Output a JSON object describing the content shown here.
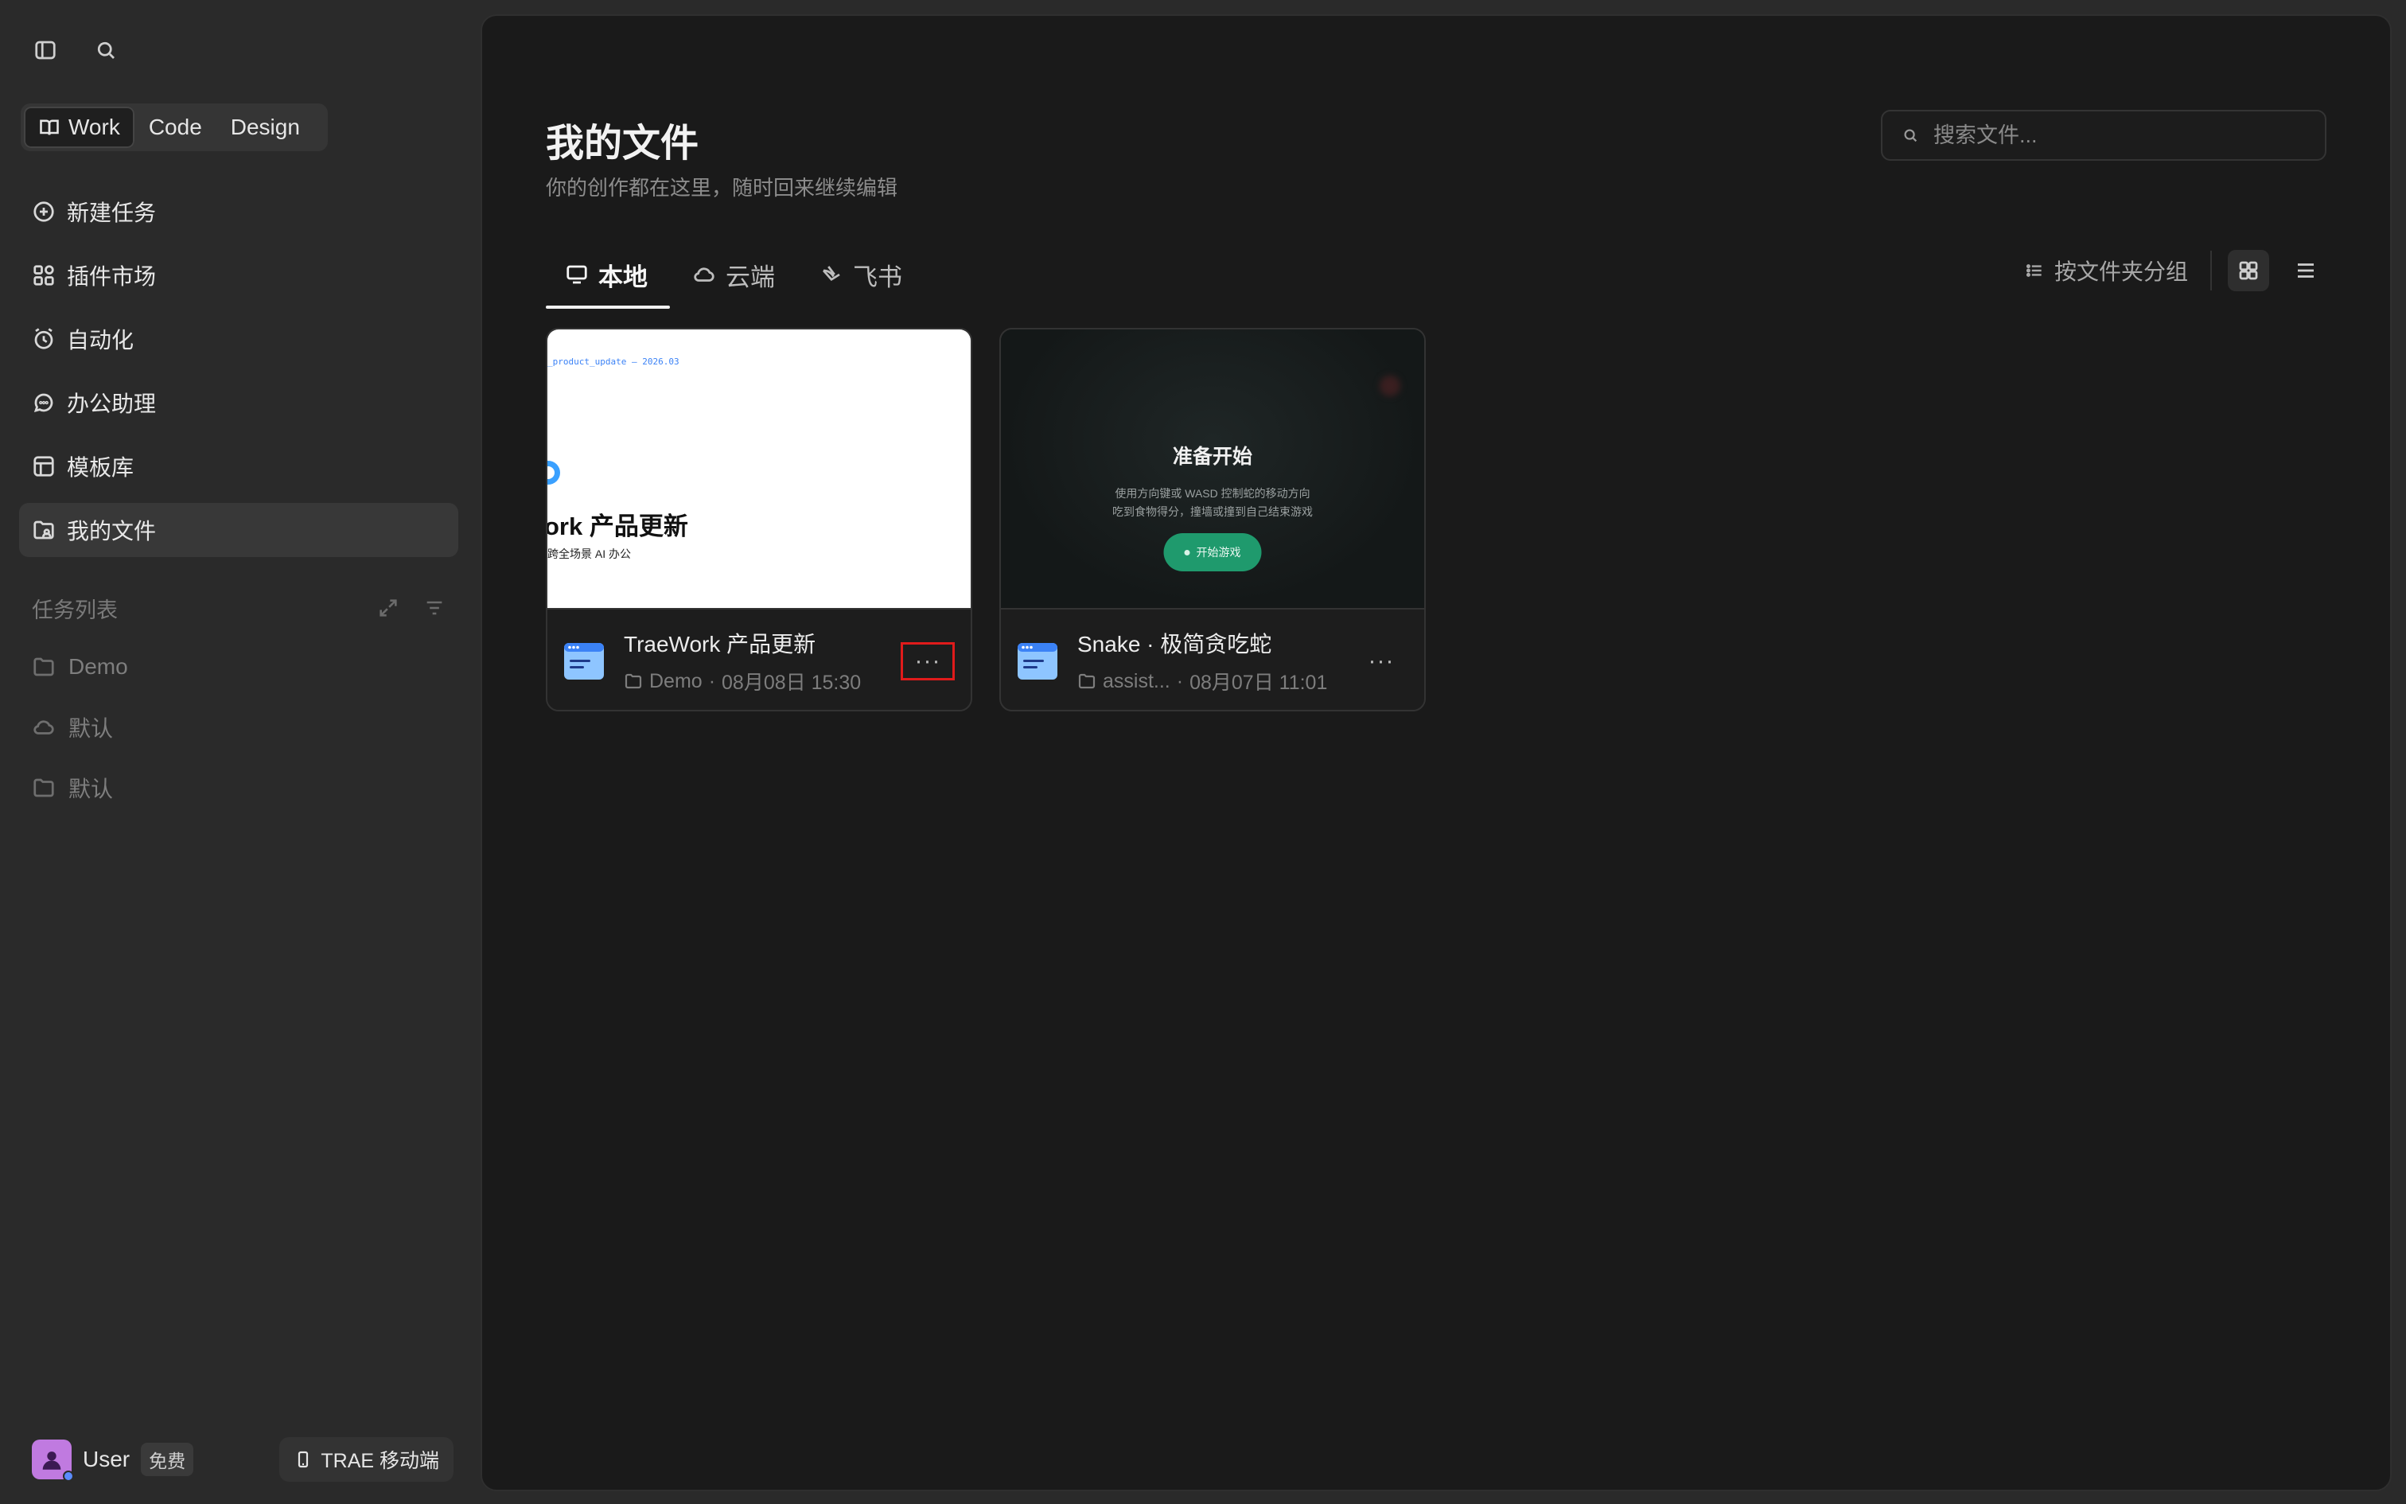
{
  "sidebar": {
    "modes": [
      "Work",
      "Code",
      "Design"
    ],
    "active_mode": "Work",
    "nav_items": [
      {
        "label": "新建任务",
        "icon": "new-task-icon"
      },
      {
        "label": "插件市场",
        "icon": "plugin-market-icon"
      },
      {
        "label": "自动化",
        "icon": "automation-clock-icon"
      },
      {
        "label": "办公助理",
        "icon": "chat-bubble-icon"
      },
      {
        "label": "模板库",
        "icon": "template-icon"
      },
      {
        "label": "我的文件",
        "icon": "my-files-icon",
        "active": true
      }
    ],
    "task_list_title": "任务列表",
    "tasks": [
      {
        "label": "Demo",
        "icon": "folder-icon"
      },
      {
        "label": "默认",
        "icon": "cloud-icon"
      },
      {
        "label": "默认",
        "icon": "folder-icon"
      }
    ],
    "footer": {
      "user_name": "User",
      "plan_badge": "免费",
      "mobile_label": "TRAE 移动端"
    }
  },
  "main": {
    "title": "我的文件",
    "subtitle": "你的创作都在这里，随时回来继续编辑",
    "search_placeholder": "搜索文件...",
    "tabs": [
      {
        "label": "本地",
        "icon": "monitor-icon",
        "active": true
      },
      {
        "label": "云端",
        "icon": "cloud-icon"
      },
      {
        "label": "飞书",
        "icon": "feishu-icon"
      }
    ],
    "group_by_label": "按文件夹分组",
    "view_mode": "grid",
    "files": [
      {
        "name": "TraeWork 产品更新",
        "folder": "Demo",
        "date": "08月08日 15:30",
        "preview": {
          "code_line": "_product_update — 2026.03",
          "headline": "ork 产品更新",
          "tagline": "跨全场景 AI 办公"
        }
      },
      {
        "name": "Snake · 极简贪吃蛇",
        "folder": "assist...",
        "date": "08月07日 11:01",
        "preview": {
          "headline": "准备开始",
          "desc_line1": "使用方向键或 WASD 控制蛇的移动方向",
          "desc_line2": "吃到食物得分，撞墙或撞到自己结束游戏",
          "button": "开始游戏"
        }
      }
    ],
    "colors": {
      "accent_green": "#1f9a6d",
      "highlight_red": "#e01b1b",
      "file_icon_blue": "#8ec5ff"
    }
  }
}
